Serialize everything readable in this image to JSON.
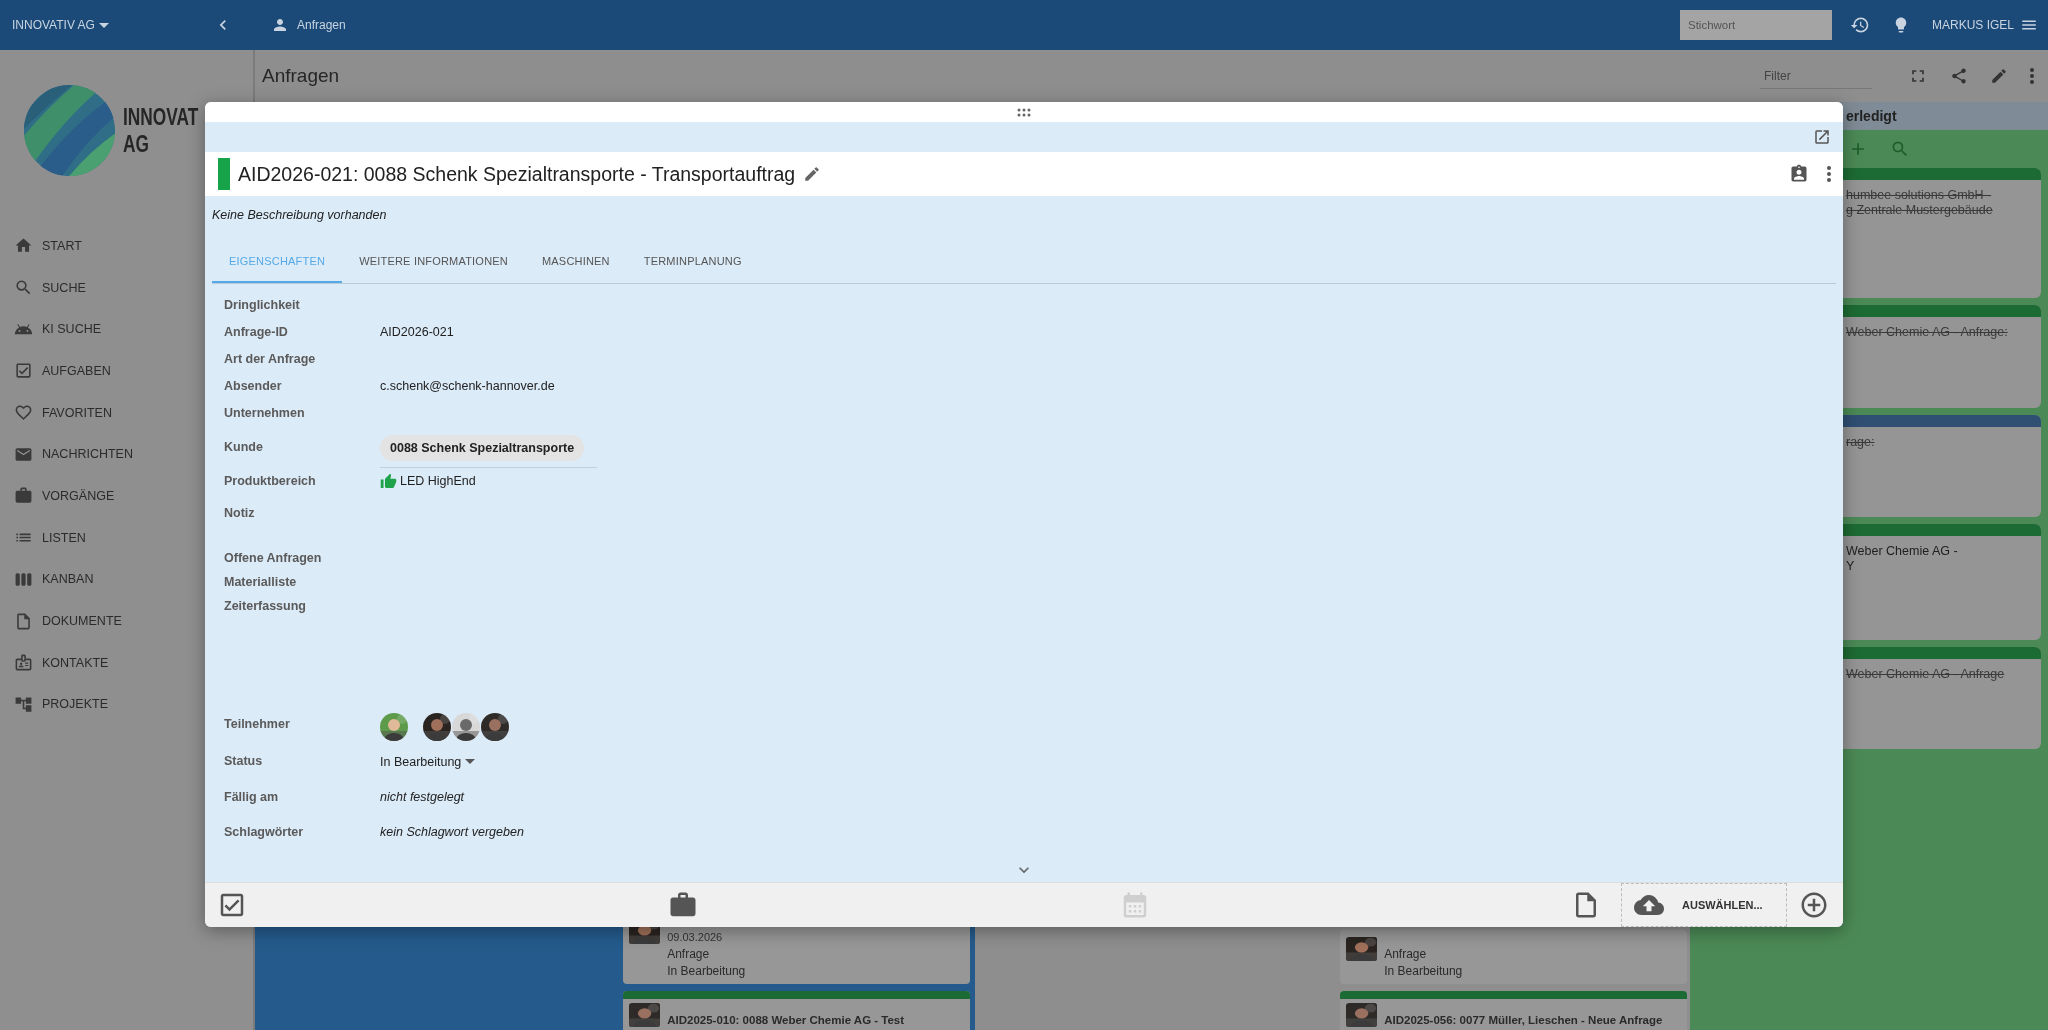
{
  "top_bar": {
    "company": "INNOVATIV AG",
    "breadcrumb": "Anfragen",
    "search": {
      "placeholder": "Stichwort"
    },
    "user": "MARKUS IGEL"
  },
  "logo": {
    "lines": [
      "INNOVAT",
      "AG"
    ]
  },
  "sidebar": {
    "items": [
      {
        "label": "START"
      },
      {
        "label": "SUCHE"
      },
      {
        "label": "KI SUCHE"
      },
      {
        "label": "AUFGABEN"
      },
      {
        "label": "FAVORITEN"
      },
      {
        "label": "NACHRICHTEN"
      },
      {
        "label": "VORGÄNGE"
      },
      {
        "label": "LISTEN"
      },
      {
        "label": "KANBAN"
      },
      {
        "label": "DOKUMENTE"
      },
      {
        "label": "KONTAKTE"
      },
      {
        "label": "PROJEKTE"
      }
    ]
  },
  "page": {
    "title": "Anfragen",
    "filter": {
      "placeholder": "Filter"
    }
  },
  "board": {
    "left_cards": [
      {
        "kind": "detail",
        "lines": [
          "09.03.2026",
          "Anfrage",
          "In Bearbeitung"
        ]
      },
      {
        "kind": "title",
        "color": "#1d6b34",
        "lines": [
          "AID2025-010: 0088 Weber Chemie AG - Test"
        ]
      }
    ],
    "middle_cards": [
      {
        "kind": "detail",
        "lines": [
          "Anfrage",
          "In Bearbeitung"
        ]
      },
      {
        "kind": "title",
        "color": "#1d6b34",
        "lines": [
          "AID2025-056: 0077 Müller, Lieschen - Neue Anfrage"
        ]
      }
    ],
    "done_column": {
      "title": "erledigt",
      "cards": [
        {
          "color": "#1d6b34",
          "done": true,
          "lines": [
            "humbee solutions GmbH -",
            "g Zentrale Mustergebäude"
          ]
        },
        {
          "color": "#1d6b34",
          "done": true,
          "lines": [
            "Weber Chemie AG - Anfrage:"
          ]
        },
        {
          "color": "#2f4f73",
          "done": true,
          "lines": [
            "rage:"
          ]
        },
        {
          "color": "#1d6b34",
          "done": false,
          "lines": [
            "Weber Chemie AG -",
            "Y"
          ]
        },
        {
          "color": "#1d6b34",
          "done": true,
          "lines": [
            "Weber Chemie AG - Anfrage"
          ]
        }
      ]
    }
  },
  "modal": {
    "title": "AID2026-021: 0088 Schenk Spezialtransporte - Transportauftrag",
    "description": "Keine Beschreibung vorhanden",
    "tabs": [
      {
        "label": "EIGENSCHAFTEN",
        "selected": true
      },
      {
        "label": "WEITERE INFORMATIONEN",
        "selected": false
      },
      {
        "label": "MASCHINEN",
        "selected": false
      },
      {
        "label": "TERMINPLANUNG",
        "selected": false
      }
    ],
    "properties": [
      {
        "label": "Dringlichkeit",
        "kind": "text"
      },
      {
        "label": "Anfrage-ID",
        "kind": "text",
        "value": "AID2026-021"
      },
      {
        "label": "Art der Anfrage",
        "kind": "text"
      },
      {
        "label": "Absender",
        "kind": "text",
        "value": "c.schenk@schenk-hannover.de"
      },
      {
        "label": "Unternehmen",
        "kind": "text"
      },
      {
        "label": "Kunde",
        "kind": "chip",
        "value": "0088 Schenk Spezialtransporte"
      },
      {
        "label": "Produktbereich",
        "kind": "product",
        "value": "LED HighEnd"
      },
      {
        "label": "Notiz",
        "kind": "note"
      },
      {
        "label": "Offene Anfragen",
        "kind": "link"
      },
      {
        "label": "Materialliste",
        "kind": "link"
      },
      {
        "label": "Zeiterfassung",
        "kind": "time"
      },
      {
        "label": "Teilnehmer",
        "kind": "people"
      },
      {
        "label": "Status",
        "kind": "select",
        "value": "In Bearbeitung"
      },
      {
        "label": "Fällig am",
        "kind": "placeholder",
        "value": "nicht festgelegt"
      },
      {
        "label": "Schlagwörter",
        "kind": "placeholder",
        "value": "kein Schlagwort vergeben"
      }
    ],
    "footer": {
      "actions": [
        {
          "kind": "tasks",
          "disabled": false
        },
        {
          "kind": "work",
          "disabled": false
        },
        {
          "kind": "calendar",
          "disabled": true
        },
        {
          "kind": "document",
          "disabled": false
        }
      ],
      "upload": {
        "label": "AUSWÄHLEN..."
      }
    }
  }
}
